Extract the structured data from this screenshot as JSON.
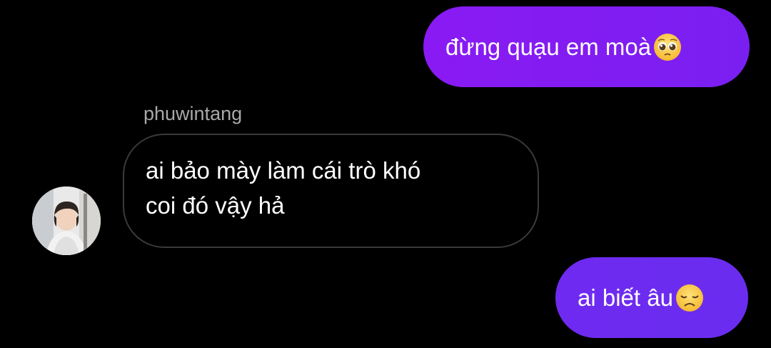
{
  "messages": [
    {
      "direction": "outgoing",
      "text": "đừng quạu em moà",
      "emoji": "pleading-face-emoji"
    },
    {
      "direction": "incoming",
      "sender": "phuwintang",
      "lines": [
        "ai bảo mày làm cái trò khó",
        "coi đó vậy hả"
      ],
      "avatar": "profile-photo"
    },
    {
      "direction": "outgoing",
      "text": "ai biết âu",
      "emoji": "disappointed-face-emoji"
    }
  ],
  "colors": {
    "background": "#000000",
    "outgoing_bubble": "#7d1cf2",
    "incoming_bubble_border": "#3a3a3a",
    "sender_name": "#a8a8a8",
    "text": "#ffffff"
  }
}
